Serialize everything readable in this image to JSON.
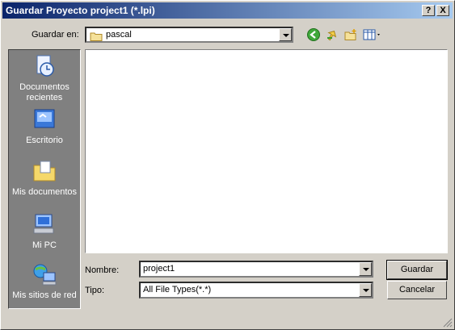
{
  "window": {
    "title": "Guardar Proyecto project1 (*.lpi)",
    "help_btn": "?",
    "close_btn": "X"
  },
  "location": {
    "label": "Guardar en:",
    "value": "pascal"
  },
  "places": [
    {
      "label": "Documentos recientes",
      "icon": "recent-documents-icon"
    },
    {
      "label": "Escritorio",
      "icon": "desktop-icon"
    },
    {
      "label": "Mis documentos",
      "icon": "my-documents-icon"
    },
    {
      "label": "Mi PC",
      "icon": "my-computer-icon"
    },
    {
      "label": "Mis sitios de red",
      "icon": "network-places-icon"
    }
  ],
  "filename": {
    "label": "Nombre:",
    "value": "project1"
  },
  "filetype": {
    "label": "Tipo:",
    "value": "All File Types(*.*)"
  },
  "buttons": {
    "save": "Guardar",
    "cancel": "Cancelar"
  },
  "colors": {
    "title_start": "#0a246a",
    "title_end": "#a6caf0",
    "face": "#d4d0c8",
    "places_bg": "#808080"
  }
}
